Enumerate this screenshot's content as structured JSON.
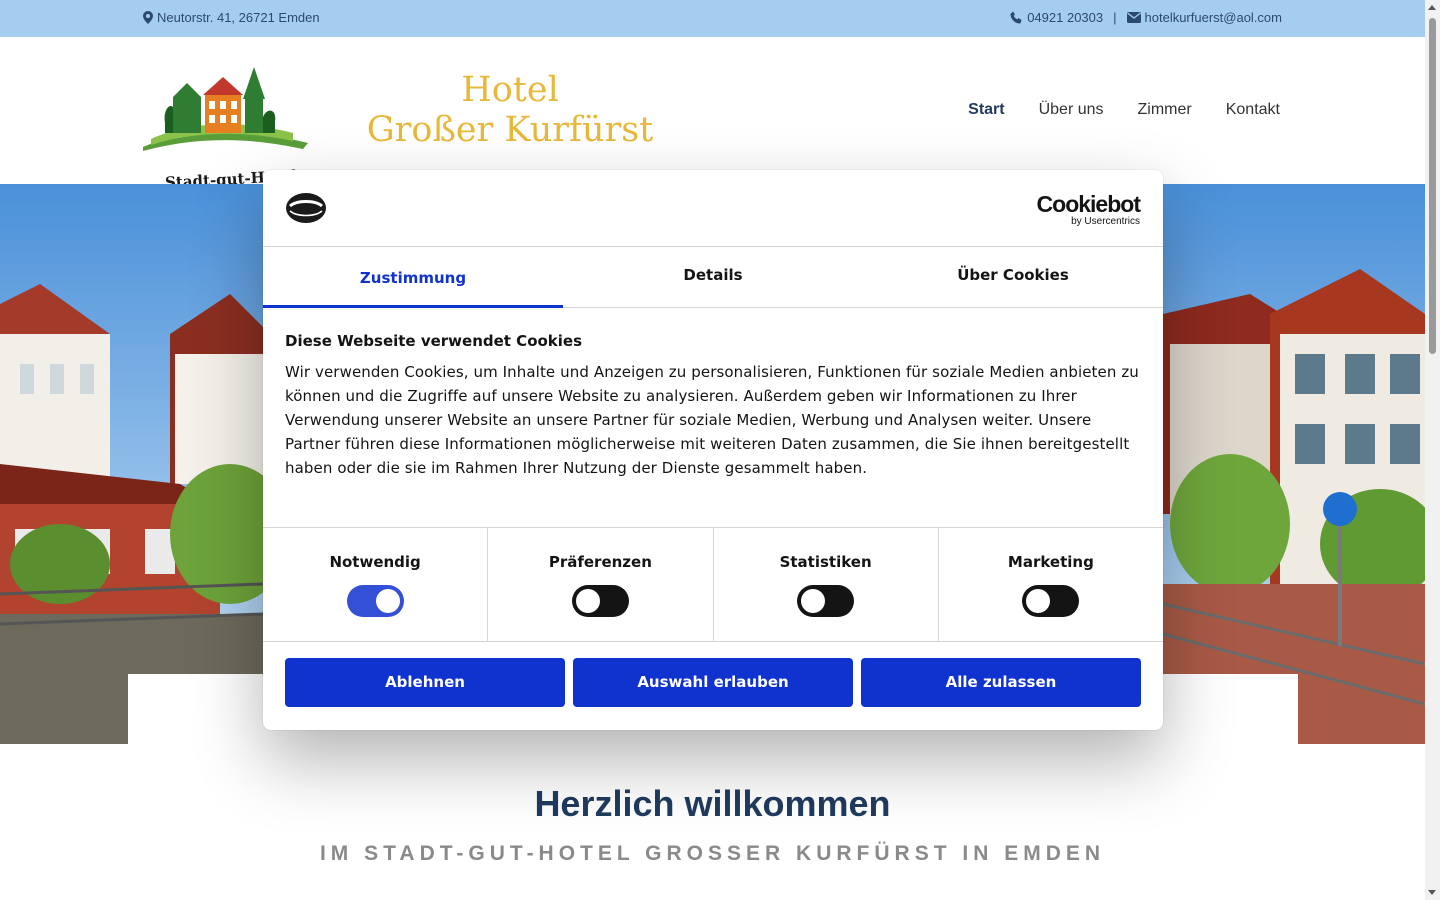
{
  "topbar": {
    "address": "Neutorstr. 41, 26721 Emden",
    "phone": "04921 20303",
    "separator": "|",
    "email": "hotelkurfuerst@aol.com",
    "icons": [
      "map-marker-icon",
      "phone-icon",
      "envelope-icon"
    ]
  },
  "header": {
    "logo_text": "Stadt-gut-Hotels",
    "hotel_line1": "Hotel",
    "hotel_line2": "Großer Kurfürst",
    "nav": [
      "Start",
      "Über uns",
      "Zimmer",
      "Kontakt"
    ],
    "active_nav": "Start"
  },
  "welcome": {
    "title": "Herzlich willkommen",
    "subtitle": "IM STADT-GUT-HOTEL GROSSER KURFÜRST IN EMDEN"
  },
  "cookie": {
    "brand_big": "Cookiebot",
    "brand_small": "by Usercentrics",
    "tabs": [
      "Zustimmung",
      "Details",
      "Über Cookies"
    ],
    "active_tab": "Zustimmung",
    "title": "Diese Webseite verwendet Cookies",
    "text": "Wir verwenden Cookies, um Inhalte und Anzeigen zu personalisieren, Funktionen für soziale Medien anbieten zu können und die Zugriffe auf unsere Website zu analysieren. Außerdem geben wir Informationen zu Ihrer Verwendung unserer Website an unsere Partner für soziale Medien, Werbung und Analysen weiter. Unsere Partner führen diese Informationen möglicherweise mit weiteren Daten zusammen, die Sie ihnen bereitgestellt haben oder die sie im Rahmen Ihrer Nutzung der Dienste gesammelt haben.",
    "toggles": [
      {
        "label": "Notwendig",
        "on": true
      },
      {
        "label": "Präferenzen",
        "on": false
      },
      {
        "label": "Statistiken",
        "on": false
      },
      {
        "label": "Marketing",
        "on": false
      }
    ],
    "buttons": [
      "Ablehnen",
      "Auswahl erlauben",
      "Alle zulassen"
    ]
  },
  "colors": {
    "accent_blue": "#1032cf",
    "topbar_bg": "#a5cdef",
    "hotel_gold": "#e8b83a",
    "heading_navy": "#1f3b5e"
  }
}
